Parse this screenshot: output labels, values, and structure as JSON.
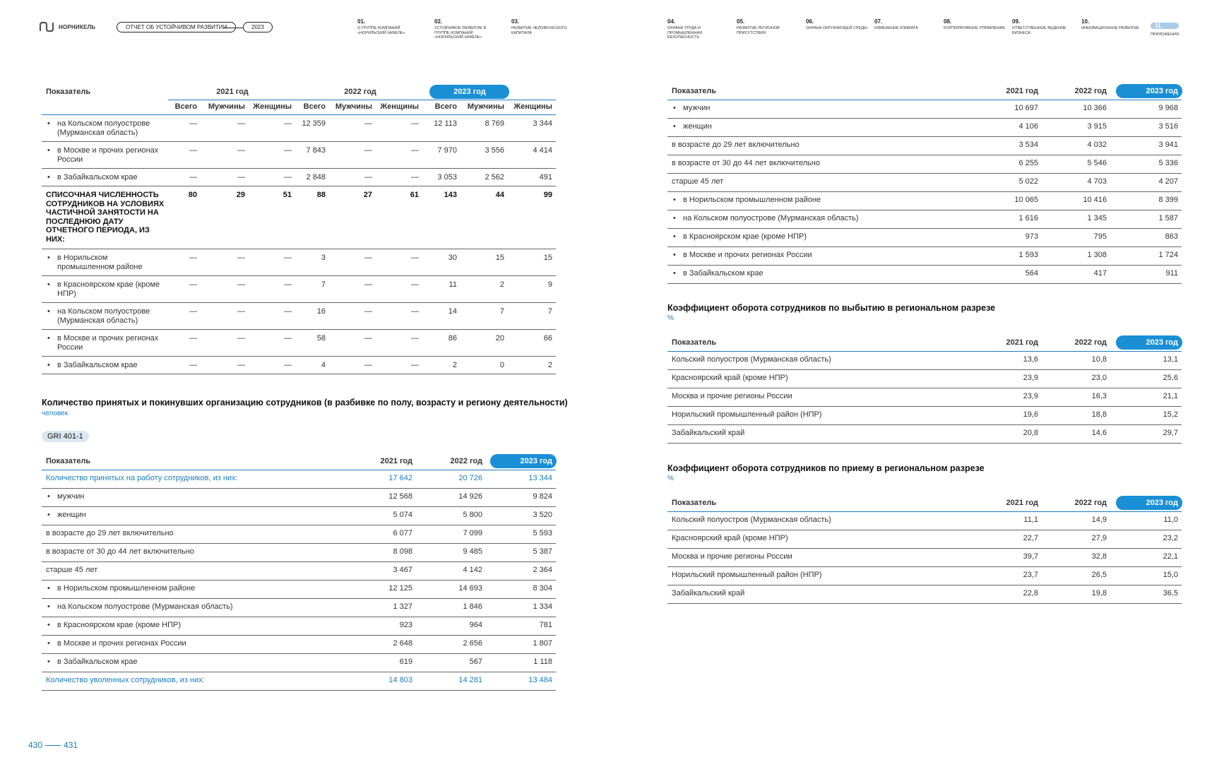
{
  "header": {
    "logo_text": "НОРНИКЕЛЬ",
    "report_title": "ОТЧЕТ ОБ УСТОЙЧИВОМ РАЗВИТИИ",
    "year": "2023",
    "nav": [
      {
        "num": "01.",
        "label": "О ГРУППЕ КОМПАНИЙ «НОРИЛЬСКИЙ НИКЕЛЬ»"
      },
      {
        "num": "02.",
        "label": "УСТОЙЧИВОЕ РАЗВИТИЕ В ГРУППЕ КОМПАНИЙ «НОРИЛЬСКИЙ НИКЕЛЬ»"
      },
      {
        "num": "03.",
        "label": "РАЗВИТИЕ ЧЕЛОВЕЧЕСКОГО КАПИТАЛА"
      },
      {
        "num": "04.",
        "label": "ОХРАНА ТРУДА И ПРОМЫШЛЕННАЯ БЕЗОПАСНОСТЬ"
      },
      {
        "num": "05.",
        "label": "РАЗВИТИЕ РЕГИОНОВ ПРИСУТСТВИЯ"
      },
      {
        "num": "06.",
        "label": "ОХРАНА ОКРУЖАЮЩЕЙ СРЕДЫ"
      },
      {
        "num": "07.",
        "label": "ИЗМЕНЕНИЕ КЛИМАТА"
      },
      {
        "num": "08.",
        "label": "КОРПОРАТИВНОЕ УПРАВЛЕНИЕ"
      },
      {
        "num": "09.",
        "label": "ОТВЕТСТВЕННОЕ ВЕДЕНИЕ БИЗНЕСА"
      },
      {
        "num": "10.",
        "label": "ИННОВАЦИОННОЕ РАЗВИТИЕ"
      },
      {
        "num": "11.",
        "label": "ПРИЛОЖЕНИЯ"
      }
    ]
  },
  "table1": {
    "col_indicator": "Показатель",
    "years": [
      "2021 год",
      "2022 год",
      "2023 год"
    ],
    "subcols": [
      "Всего",
      "Мужчины",
      "Женщины"
    ],
    "rows": [
      {
        "label": "на Кольском полуострове (Мурманская область)",
        "bullet": true,
        "values": [
          "—",
          "—",
          "—",
          "12 359",
          "—",
          "—",
          "12 113",
          "8 769",
          "3 344"
        ]
      },
      {
        "label": "в Москве и прочих регионах России",
        "bullet": true,
        "values": [
          "—",
          "—",
          "—",
          "7 843",
          "—",
          "—",
          "7 970",
          "3 556",
          "4 414"
        ]
      },
      {
        "label": "в Забайкальском крае",
        "bullet": true,
        "values": [
          "—",
          "—",
          "—",
          "2 848",
          "—",
          "—",
          "3 053",
          "2 562",
          "491"
        ]
      },
      {
        "label": "СПИСОЧНАЯ ЧИСЛЕННОСТЬ СОТРУДНИКОВ НА УСЛОВИЯХ ЧАСТИЧНОЙ ЗАНЯТОСТИ НА ПОСЛЕДНЮЮ ДАТУ ОТЧЕТНОГО ПЕРИОДА, ИЗ НИХ:",
        "bold": true,
        "values": [
          "80",
          "29",
          "51",
          "88",
          "27",
          "61",
          "143",
          "44",
          "99"
        ]
      },
      {
        "label": "в Норильском промышленном районе",
        "bullet": true,
        "values": [
          "—",
          "—",
          "—",
          "3",
          "—",
          "—",
          "30",
          "15",
          "15"
        ]
      },
      {
        "label": "в Красноярском крае (кроме НПР)",
        "bullet": true,
        "values": [
          "—",
          "—",
          "—",
          "7",
          "—",
          "—",
          "11",
          "2",
          "9"
        ]
      },
      {
        "label": "на Кольском полуострове (Мурманская область)",
        "bullet": true,
        "values": [
          "—",
          "—",
          "—",
          "16",
          "—",
          "—",
          "14",
          "7",
          "7"
        ]
      },
      {
        "label": "в Москве и прочих регионах России",
        "bullet": true,
        "values": [
          "—",
          "—",
          "—",
          "58",
          "—",
          "—",
          "86",
          "20",
          "66"
        ]
      },
      {
        "label": "в Забайкальском крае",
        "bullet": true,
        "values": [
          "—",
          "—",
          "—",
          "4",
          "—",
          "—",
          "2",
          "0",
          "2"
        ]
      }
    ]
  },
  "table2": {
    "title": "Количество принятых и покинувших организацию сотрудников (в разбивке по полу, возрасту и региону деятельности)",
    "unit": "человек",
    "gri": "GRI 401-1",
    "col_indicator": "Показатель",
    "years": [
      "2021 год",
      "2022 год",
      "2023 год"
    ],
    "rows": [
      {
        "label": "Количество принятых на работу сотрудников, из них:",
        "blue": true,
        "values": [
          "17 642",
          "20 726",
          "13 344"
        ]
      },
      {
        "label": "мужчин",
        "bullet": true,
        "values": [
          "12 568",
          "14 926",
          "9 824"
        ]
      },
      {
        "label": "женщин",
        "bullet": true,
        "values": [
          "5 074",
          "5 800",
          "3 520"
        ]
      },
      {
        "label": "в возрасте до 29 лет включительно",
        "values": [
          "6 077",
          "7 099",
          "5 593"
        ]
      },
      {
        "label": "в возрасте от 30 до 44 лет включительно",
        "values": [
          "8 098",
          "9 485",
          "5 387"
        ]
      },
      {
        "label": "старше 45 лет",
        "values": [
          "3 467",
          "4 142",
          "2 364"
        ]
      },
      {
        "label": "в Норильском промышленном районе",
        "bullet": true,
        "values": [
          "12 125",
          "14 693",
          "8 304"
        ]
      },
      {
        "label": "на Кольском полуострове (Мурманская область)",
        "bullet": true,
        "values": [
          "1 327",
          "1 846",
          "1 334"
        ]
      },
      {
        "label": "в Красноярском крае (кроме НПР)",
        "bullet": true,
        "values": [
          "923",
          "964",
          "781"
        ]
      },
      {
        "label": "в Москве и прочих регионах России",
        "bullet": true,
        "values": [
          "2 648",
          "2 656",
          "1 807"
        ]
      },
      {
        "label": "в Забайкальском крае",
        "bullet": true,
        "values": [
          "619",
          "567",
          "1 118"
        ]
      },
      {
        "label": "Количество уволенных сотрудников, из них:",
        "blue": true,
        "values": [
          "14 803",
          "14 281",
          "13 484"
        ]
      }
    ]
  },
  "table3": {
    "col_indicator": "Показатель",
    "years": [
      "2021 год",
      "2022 год",
      "2023 год"
    ],
    "rows": [
      {
        "label": "мужчин",
        "bullet": true,
        "values": [
          "10 697",
          "10 366",
          "9 968"
        ]
      },
      {
        "label": "женщин",
        "bullet": true,
        "values": [
          "4 106",
          "3 915",
          "3 516"
        ]
      },
      {
        "label": "в возрасте до 29 лет включительно",
        "values": [
          "3 534",
          "4 032",
          "3 941"
        ]
      },
      {
        "label": "в возрасте от 30 до 44 лет включительно",
        "values": [
          "6 255",
          "5 546",
          "5 336"
        ]
      },
      {
        "label": "старше 45 лет",
        "values": [
          "5 022",
          "4 703",
          "4 207"
        ]
      },
      {
        "label": "в Норильском промышленном районе",
        "bullet": true,
        "values": [
          "10 065",
          "10 416",
          "8 399"
        ]
      },
      {
        "label": "на Кольском полуострове (Мурманская область)",
        "bullet": true,
        "values": [
          "1 616",
          "1 345",
          "1 587"
        ]
      },
      {
        "label": "в Красноярском крае (кроме НПР)",
        "bullet": true,
        "values": [
          "973",
          "795",
          "863"
        ]
      },
      {
        "label": "в Москве и прочих регионах России",
        "bullet": true,
        "values": [
          "1 593",
          "1 308",
          "1 724"
        ]
      },
      {
        "label": "в Забайкальском крае",
        "bullet": true,
        "values": [
          "564",
          "417",
          "911"
        ]
      }
    ]
  },
  "table4": {
    "title": "Коэффициент оборота сотрудников по выбытию в региональном разрезе",
    "unit": "%",
    "col_indicator": "Показатель",
    "years": [
      "2021 год",
      "2022 год",
      "2023 год"
    ],
    "rows": [
      {
        "label": "Кольский полуостров (Мурманская область)",
        "values": [
          "13,6",
          "10,8",
          "13,1"
        ]
      },
      {
        "label": "Красноярский край (кроме НПР)",
        "values": [
          "23,9",
          "23,0",
          "25,6"
        ]
      },
      {
        "label": "Москва и прочие регионы России",
        "values": [
          "23,9",
          "16,3",
          "21,1"
        ]
      },
      {
        "label": "Норильский промышленный район (НПР)",
        "values": [
          "19,6",
          "18,8",
          "15,2"
        ]
      },
      {
        "label": "Забайкальский край",
        "values": [
          "20,8",
          "14,6",
          "29,7"
        ]
      }
    ]
  },
  "table5": {
    "title": "Коэффициент оборота сотрудников по приему в региональном разрезе",
    "unit": "%",
    "col_indicator": "Показатель",
    "years": [
      "2021 год",
      "2022 год",
      "2023 год"
    ],
    "rows": [
      {
        "label": "Кольский полуостров (Мурманская область)",
        "values": [
          "11,1",
          "14,9",
          "11,0"
        ]
      },
      {
        "label": "Красноярский край (кроме НПР)",
        "values": [
          "22,7",
          "27,9",
          "23,2"
        ]
      },
      {
        "label": "Москва и прочие регионы России",
        "values": [
          "39,7",
          "32,8",
          "22,1"
        ]
      },
      {
        "label": "Норильский промышленный район (НПР)",
        "values": [
          "23,7",
          "26,5",
          "15,0"
        ]
      },
      {
        "label": "Забайкальский край",
        "values": [
          "22,8",
          "19,8",
          "36,5"
        ]
      }
    ]
  },
  "footer": {
    "page_left": "430",
    "page_right": "431"
  },
  "colors": {
    "accent": "#1a8fd6",
    "accent_text": "#1a7cc1",
    "rule": "#666666"
  }
}
